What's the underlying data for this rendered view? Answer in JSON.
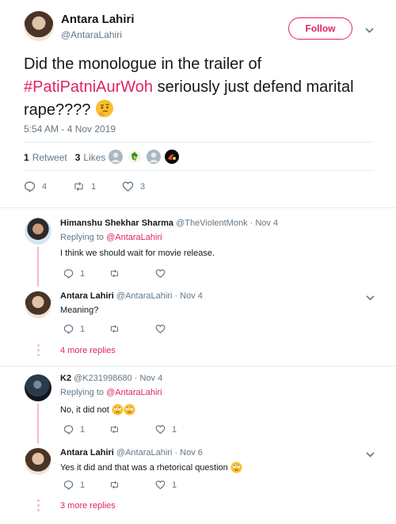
{
  "main_tweet": {
    "author_name": "Antara Lahiri",
    "author_handle": "@AntaraLahiri",
    "follow_label": "Follow",
    "text_before": "Did the monologue in the trailer of ",
    "hashtag": "#PatiPatniAurWoh",
    "text_after": " seriously just defend marital rape????",
    "timestamp": "5:54 AM - 4 Nov 2019",
    "retweet_count": "1",
    "retweet_label": "Retweet",
    "like_count": "3",
    "like_label": "Likes",
    "reply_count": "4",
    "retweet_action_count": "1",
    "like_action_count": "3"
  },
  "replies": [
    {
      "name": "Himanshu Shekhar Sharma",
      "meta": "@TheViolentMonk · Nov 4",
      "replying_prefix": "Replying to ",
      "replying_to": "@AntaraLahiri",
      "text": "I think we should wait for movie release.",
      "reply_count": "1",
      "retweet_count": "",
      "like_count": ""
    },
    {
      "name": "Antara Lahiri",
      "meta": "@AntaraLahiri · Nov 4",
      "text": "Meaning?",
      "reply_count": "1",
      "retweet_count": "",
      "like_count": "",
      "more_replies": "4 more replies"
    },
    {
      "name": "K2",
      "meta": "@K231998680 · Nov 4",
      "replying_prefix": "Replying to ",
      "replying_to": "@AntaraLahiri",
      "text": "No, it did not",
      "reply_count": "1",
      "retweet_count": "",
      "like_count": "1"
    },
    {
      "name": "Antara Lahiri",
      "meta": "@AntaraLahiri · Nov 6",
      "text": "Yes it did and that was a rhetorical question",
      "reply_count": "1",
      "retweet_count": "",
      "like_count": "1",
      "more_replies": "3 more replies"
    }
  ],
  "colors": {
    "accent": "#e0245e",
    "secondary_text": "#657786",
    "primary_text": "#14171a",
    "thread_line": "#f5b8cc"
  }
}
